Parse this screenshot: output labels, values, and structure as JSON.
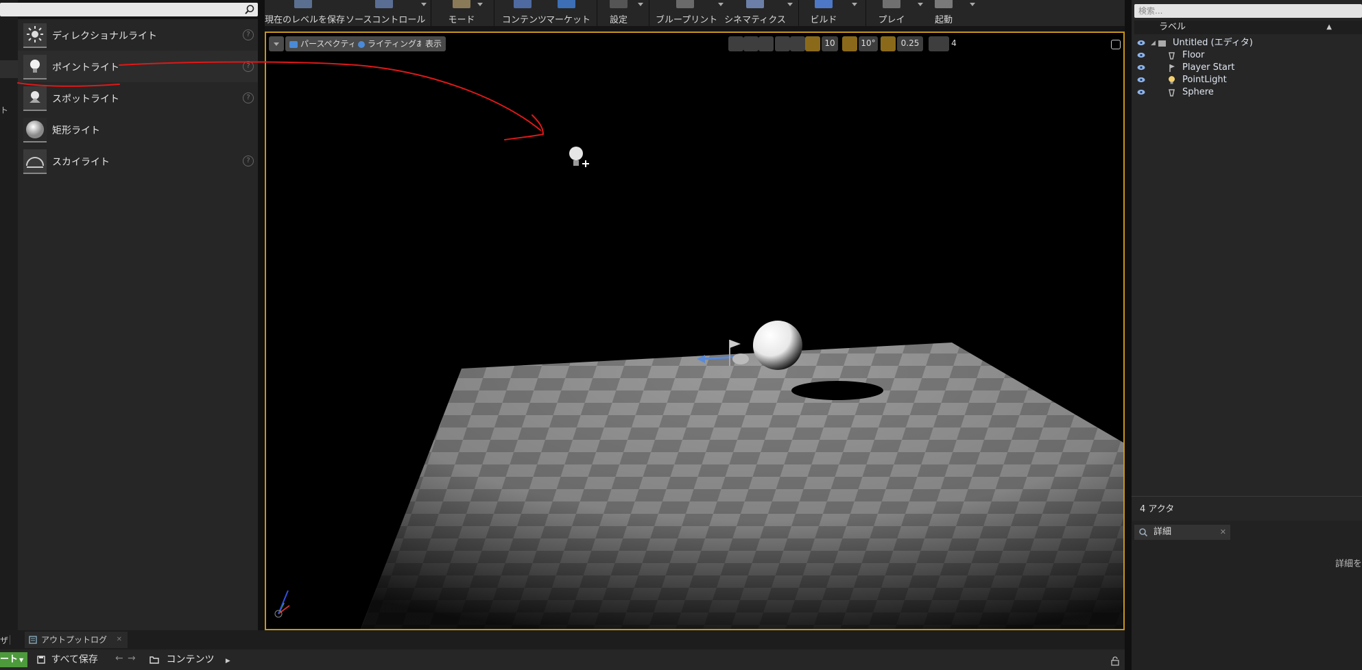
{
  "left_panel": {
    "fragment_text": "ト",
    "items": [
      {
        "label": "ディレクショナルライト",
        "icon": "sun-icon",
        "help": "?"
      },
      {
        "label": "ポイントライト",
        "icon": "bulb-icon",
        "help": "?"
      },
      {
        "label": "スポットライト",
        "icon": "spotlight-icon",
        "help": "?"
      },
      {
        "label": "矩形ライト",
        "icon": "rect-light-icon",
        "help": ""
      },
      {
        "label": "スカイライト",
        "icon": "skylight-icon",
        "help": "?"
      }
    ]
  },
  "toolbar": {
    "save_level": "現在のレベルを保存",
    "source_control": "ソースコントロール",
    "modes": "モード",
    "content": "コンテンツ",
    "market": "マーケット",
    "settings": "設定",
    "blueprints": "ブループリント",
    "cinematics": "シネマティクス",
    "build": "ビルド",
    "play": "プレイ",
    "launch": "起動"
  },
  "viewport": {
    "perspective": "パースペクティブ",
    "lighting": "ライティングあり",
    "show": "表示",
    "grid_snap": "10",
    "rotation_snap": "10°",
    "scale_snap": "0.25",
    "camera_speed": "4"
  },
  "outliner": {
    "search_placeholder": "検索...",
    "header_label": "ラベル",
    "rows": [
      {
        "label": "Untitled (エディタ)",
        "icon": "world-icon"
      },
      {
        "label": "Floor",
        "icon": "mesh-icon"
      },
      {
        "label": "Player Start",
        "icon": "player-start-icon"
      },
      {
        "label": "PointLight",
        "icon": "light-icon"
      },
      {
        "label": "Sphere",
        "icon": "mesh-icon"
      }
    ],
    "actor_count": "4 アクタ"
  },
  "details": {
    "tab_label": "詳細",
    "fragment_text": "詳細を"
  },
  "bottom": {
    "tab_fragment": "ザ",
    "output_log_tab": "アウトプットログ",
    "import_fragment": "ート",
    "save_all": "すべて保存",
    "content_path": "コンテンツ"
  },
  "colors": {
    "viewport_border": "#c8961c",
    "annotation_stroke": "#e01818",
    "import_button": "#4d9a3c"
  }
}
